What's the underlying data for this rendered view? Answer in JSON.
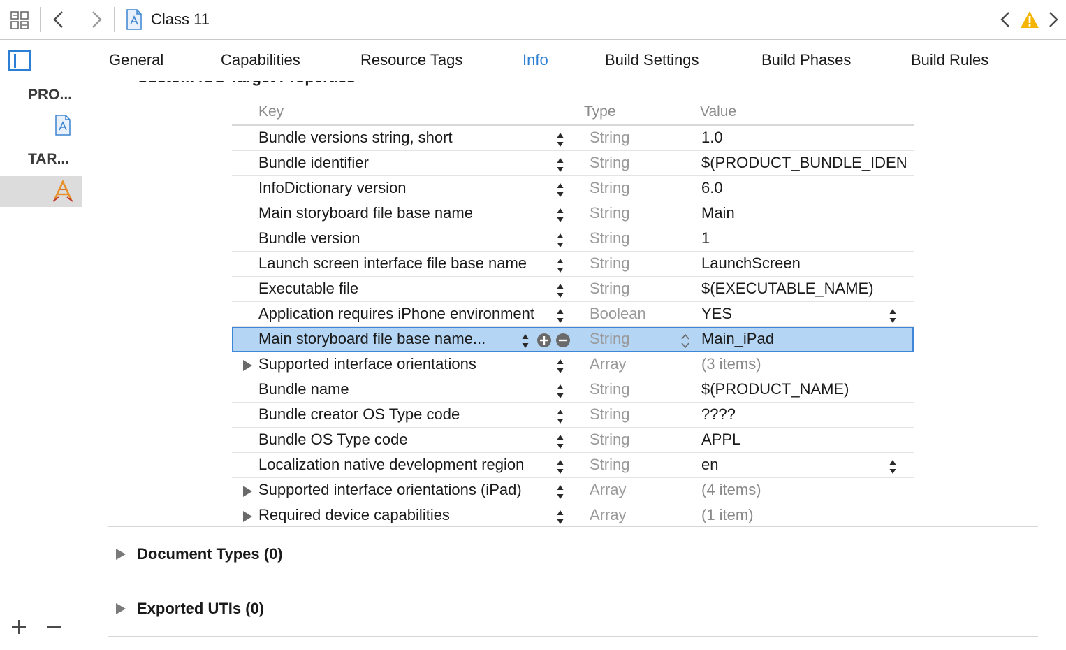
{
  "toolbar": {
    "crumb": "Class 11"
  },
  "tabs": [
    "General",
    "Capabilities",
    "Resource Tags",
    "Info",
    "Build Settings",
    "Build Phases",
    "Build Rules"
  ],
  "active_tab": "Info",
  "sidebar": {
    "project_header": "PRO...",
    "targets_header": "TAR..."
  },
  "section_title": "Custom iOS Target Properties",
  "table": {
    "headers": {
      "key": "Key",
      "type": "Type",
      "value": "Value"
    },
    "rows": [
      {
        "key": "Bundle versions string, short",
        "type": "String",
        "value": "1.0"
      },
      {
        "key": "Bundle identifier",
        "type": "String",
        "value": "$(PRODUCT_BUNDLE_IDEN"
      },
      {
        "key": "InfoDictionary version",
        "type": "String",
        "value": "6.0"
      },
      {
        "key": "Main storyboard file base name",
        "type": "String",
        "value": "Main"
      },
      {
        "key": "Bundle version",
        "type": "String",
        "value": "1"
      },
      {
        "key": "Launch screen interface file base name",
        "type": "String",
        "value": "LaunchScreen"
      },
      {
        "key": "Executable file",
        "type": "String",
        "value": "$(EXECUTABLE_NAME)"
      },
      {
        "key": "Application requires iPhone environment",
        "type": "Boolean",
        "value": "YES"
      },
      {
        "key": "Main storyboard file base name...",
        "type": "String",
        "value": "Main_iPad"
      },
      {
        "key": "Supported interface orientations",
        "type": "Array",
        "value": "(3 items)"
      },
      {
        "key": "Bundle name",
        "type": "String",
        "value": "$(PRODUCT_NAME)"
      },
      {
        "key": "Bundle creator OS Type code",
        "type": "String",
        "value": "????"
      },
      {
        "key": "Bundle OS Type code",
        "type": "String",
        "value": "APPL"
      },
      {
        "key": "Localization native development region",
        "type": "String",
        "value": "en"
      },
      {
        "key": "Supported interface orientations (iPad)",
        "type": "Array",
        "value": "(4 items)"
      },
      {
        "key": "Required device capabilities",
        "type": "Array",
        "value": "(1 item)"
      }
    ]
  },
  "groups": {
    "document_types": "Document Types (0)",
    "exported_utis": "Exported UTIs (0)"
  },
  "colors": {
    "accent": "#2c7fd4",
    "selection": "#b5d5f5",
    "warning": "#f5b400"
  }
}
